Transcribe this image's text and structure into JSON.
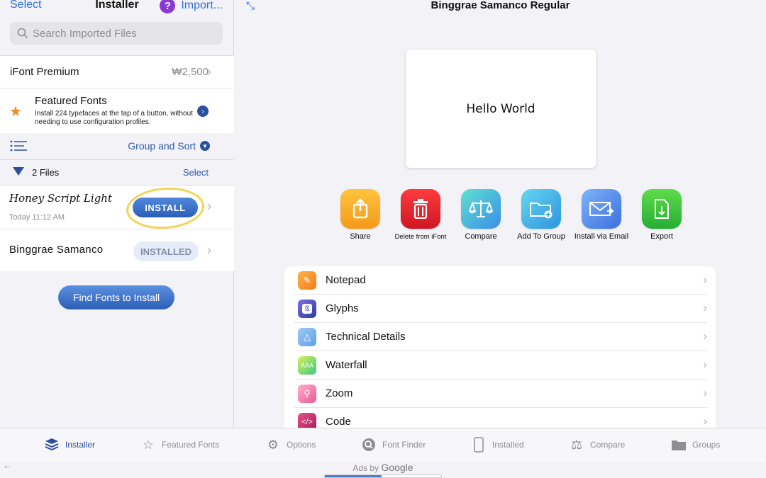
{
  "left": {
    "nav": {
      "select": "Select",
      "title": "Installer",
      "import": "Import...",
      "import_icon": "?"
    },
    "search": {
      "placeholder": "Search Imported Files"
    },
    "premium": {
      "label": "iFont Premium",
      "price": "₩2,500"
    },
    "featured": {
      "title": "Featured Fonts",
      "description": "Install 224 typefaces at the tap of a button, without needing to use configuration profiles."
    },
    "group_sort": {
      "label": "Group and Sort"
    },
    "files_header": {
      "label": "2 Files",
      "select": "Select"
    },
    "files": [
      {
        "name": "Honey Script Light",
        "time": "Today 11:12 AM",
        "action": "INSTALL"
      },
      {
        "name": "Binggrae Samanco",
        "action": "INSTALLED"
      }
    ],
    "find_button": "Find Fonts to Install"
  },
  "right": {
    "title": "Binggrae Samanco Regular",
    "preview_text": "Hello World",
    "actions": [
      {
        "label": "Share",
        "icon": "share-icon",
        "color": "#f5a623"
      },
      {
        "label": "Delete from iFont",
        "icon": "trash-icon",
        "color": "#e0242f"
      },
      {
        "label": "Compare",
        "icon": "scales-icon",
        "color": "#2ec4c4"
      },
      {
        "label": "Add To Group",
        "icon": "folder-add-icon",
        "color": "#36a8e6"
      },
      {
        "label": "Install via Email",
        "icon": "mail-icon",
        "color": "#5a8de8"
      },
      {
        "label": "Export",
        "icon": "export-icon",
        "color": "#3cbf3c"
      }
    ],
    "menu": [
      {
        "label": "Notepad",
        "icon": "pencil-icon",
        "color": "#f09a2a"
      },
      {
        "label": "Glyphs",
        "icon": "glyph-icon",
        "color": "#3c4ba8"
      },
      {
        "label": "Technical Details",
        "icon": "compass-icon",
        "color": "#6aa6e6"
      },
      {
        "label": "Waterfall",
        "icon": "waterfall-icon",
        "color": "#7cc84a"
      },
      {
        "label": "Zoom",
        "icon": "zoom-icon",
        "color": "#e85a9a"
      },
      {
        "label": "Code",
        "icon": "code-icon",
        "color": "#c0306a"
      }
    ]
  },
  "tabs": [
    {
      "label": "Installer",
      "icon": "installer-icon",
      "active": true
    },
    {
      "label": "Featured Fonts",
      "icon": "star-icon",
      "active": false
    },
    {
      "label": "Options",
      "icon": "gear-icon",
      "active": false
    },
    {
      "label": "Font Finder",
      "icon": "search-icon",
      "active": false
    },
    {
      "label": "Installed",
      "icon": "phone-icon",
      "active": false
    },
    {
      "label": "Compare",
      "icon": "scales-icon",
      "active": false
    },
    {
      "label": "Groups",
      "icon": "folder-icon",
      "active": false
    }
  ],
  "ads": {
    "prefix": "Ads by",
    "brand": "Google"
  }
}
